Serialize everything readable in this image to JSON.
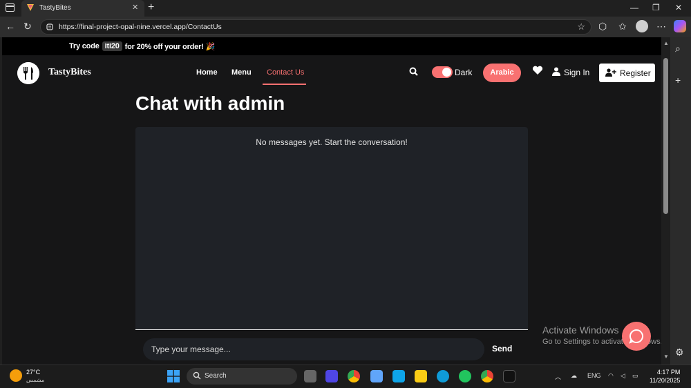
{
  "browser": {
    "tab_title": "TastyBites",
    "tab_close": "✕",
    "new_tab": "+",
    "url": "https://final-project-opal-nine.vercel.app/ContactUs",
    "win_min": "—",
    "win_max": "❐",
    "win_close": "✕"
  },
  "promo": {
    "prefix": "Try code",
    "code": "iti20",
    "suffix": "for 20% off your order! 🎉"
  },
  "nav": {
    "brand": "TastyBites",
    "links": [
      "Home",
      "Menu",
      "Contact Us"
    ],
    "active_link": "Contact Us",
    "theme_label": "Dark",
    "language_button": "Arabic",
    "sign_in": "Sign In",
    "register": "Register"
  },
  "chat": {
    "title": "Chat with admin",
    "empty_message": "No messages yet. Start the conversation!",
    "input_placeholder": "Type your message...",
    "send_label": "Send"
  },
  "watermark": {
    "line1": "Activate Windows",
    "line2": "Go to Settings to activate Windows."
  },
  "taskbar": {
    "weather_temp": "27°C",
    "weather_desc": "مشمس",
    "search_label": "Search",
    "language": "ENG",
    "time": "4:17 PM",
    "date": "11/20/2025"
  },
  "colors": {
    "accent": "#f87171",
    "page_bg": "#161617",
    "chat_bg": "#1f2227"
  }
}
